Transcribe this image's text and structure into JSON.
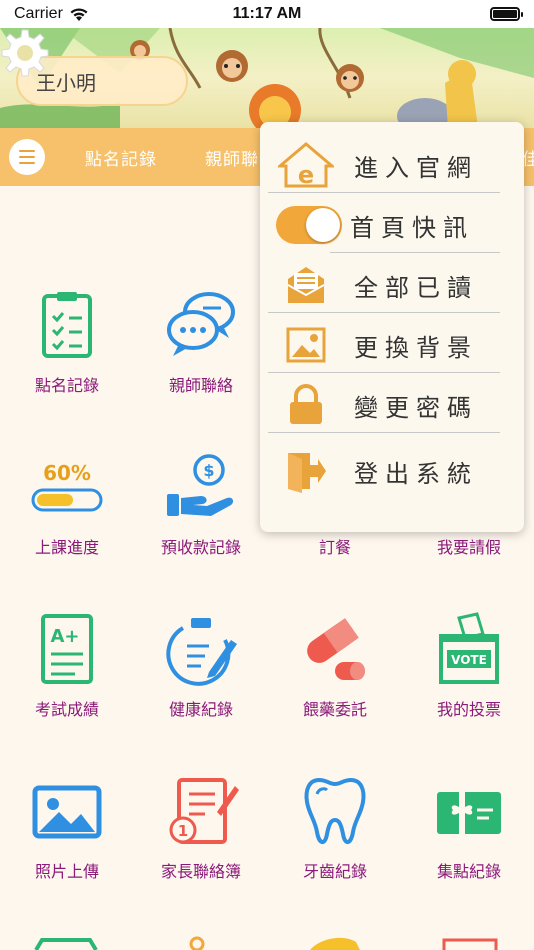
{
  "status": {
    "carrier": "Carrier",
    "time": "11:17 AM"
  },
  "header": {
    "user_name": "王小明"
  },
  "nav": {
    "items": [
      "點名記錄",
      "親師聯",
      "佳"
    ]
  },
  "menu": {
    "items": [
      "進入官網",
      "首頁快訊",
      "全部已讀",
      "更換背景",
      "變更密碼",
      "登出系統"
    ],
    "toggle_on": true
  },
  "grid": {
    "items": [
      {
        "label": "點名記錄",
        "icon": "clipboard-check-icon"
      },
      {
        "label": "親師聯絡",
        "icon": "chat-bubbles-icon"
      },
      {
        "label": "上課進度",
        "icon": "progress-bar-icon",
        "progress_text": "60%",
        "progress": 0.6
      },
      {
        "label": "預收款記錄",
        "icon": "hand-coin-icon"
      },
      {
        "label": "訂餐",
        "icon": "meal-icon"
      },
      {
        "label": "我要請假",
        "icon": "leave-icon"
      },
      {
        "label": "考試成績",
        "icon": "grade-sheet-icon",
        "grade_text": "A+"
      },
      {
        "label": "健康紀錄",
        "icon": "health-clipboard-icon"
      },
      {
        "label": "餵藥委託",
        "icon": "medicine-pill-icon"
      },
      {
        "label": "我的投票",
        "icon": "ballot-box-icon",
        "vote_text": "VOTE"
      },
      {
        "label": "照片上傳",
        "icon": "photo-icon"
      },
      {
        "label": "家長聯絡簿",
        "icon": "notebook-icon"
      },
      {
        "label": "牙齒紀錄",
        "icon": "tooth-icon"
      },
      {
        "label": "集點紀錄",
        "icon": "gift-card-icon"
      }
    ]
  },
  "colors": {
    "nav": "#f6c16a",
    "accent": "#f2a73a",
    "label": "#8b1a7a",
    "green": "#2bb673",
    "blue": "#2f8fe0",
    "red": "#ee5a4d"
  }
}
